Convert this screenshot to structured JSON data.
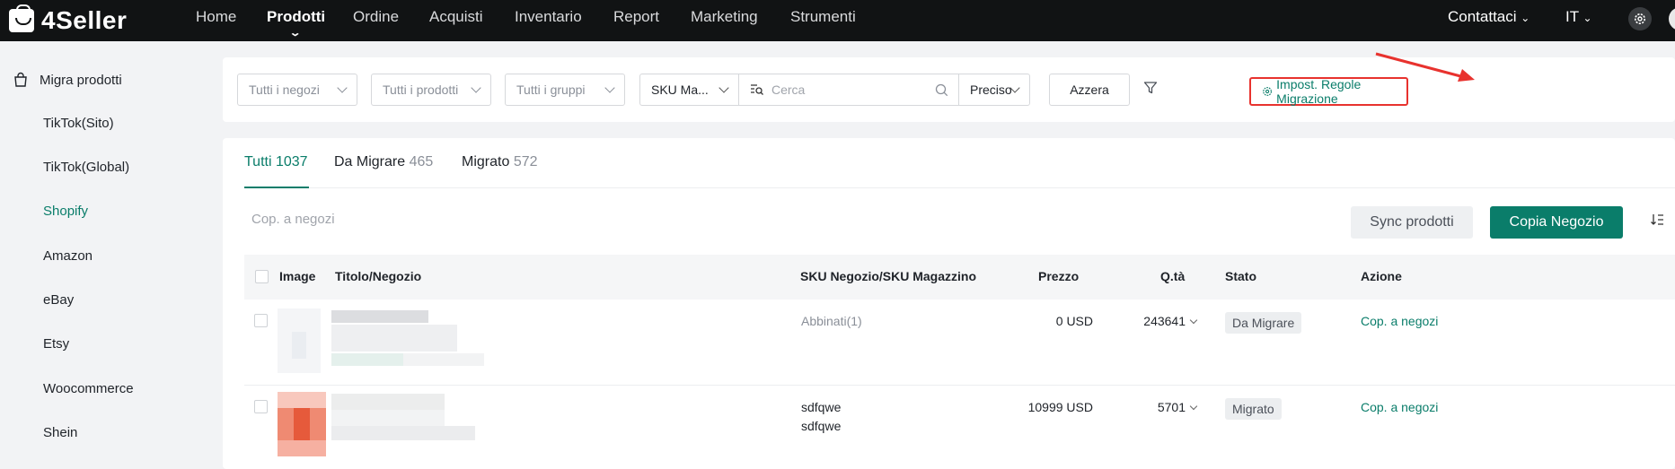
{
  "brand": {
    "name": "4Seller"
  },
  "nav": {
    "items": [
      "Home",
      "Prodotti",
      "Ordine",
      "Acquisti",
      "Inventario",
      "Report",
      "Marketing",
      "Strumenti"
    ],
    "active": "Prodotti",
    "contact": "Contattaci",
    "language": "IT"
  },
  "sidebar": {
    "heading": "Migra prodotti",
    "items": [
      "TikTok(Sito)",
      "TikTok(Global)",
      "Shopify",
      "Amazon",
      "eBay",
      "Etsy",
      "Woocommerce",
      "Shein"
    ],
    "active": "Shopify"
  },
  "filters": {
    "stores": "Tutti i negozi",
    "products": "Tutti i prodotti",
    "groups": "Tutti i gruppi",
    "sku_type": "SKU Ma...",
    "search_placeholder": "Cerca",
    "match": "Preciso",
    "reset": "Azzera",
    "rules_link": "Impost. Regole Migrazione"
  },
  "tabs": [
    {
      "label": "Tutti",
      "count": "1037"
    },
    {
      "label": "Da Migrare",
      "count": "465"
    },
    {
      "label": "Migrato",
      "count": "572"
    }
  ],
  "toolbar": {
    "copy_selected": "Cop. a negozi",
    "sync": "Sync prodotti",
    "copy_store": "Copia Negozio"
  },
  "table": {
    "headers": [
      "Image",
      "Titolo/Negozio",
      "SKU Negozio/SKU Magazzino",
      "Prezzo",
      "Q.tà",
      "Stato",
      "Azione"
    ],
    "rows": [
      {
        "sku_label": "Abbinati",
        "sku_count": "(1)",
        "sku_line2": "",
        "price": "0 USD",
        "qty": "243641",
        "status": "Da Migrare",
        "action": "Cop. a negozi"
      },
      {
        "sku_label": "sdfqwe",
        "sku_count": "",
        "sku_line2": "sdfqwe",
        "price": "10999 USD",
        "qty": "5701",
        "status": "Migrato",
        "action": "Cop. a negozi"
      }
    ]
  },
  "colors": {
    "accent": "#0a7d6a",
    "highlight": "#e8322e",
    "topbar": "#111314"
  }
}
